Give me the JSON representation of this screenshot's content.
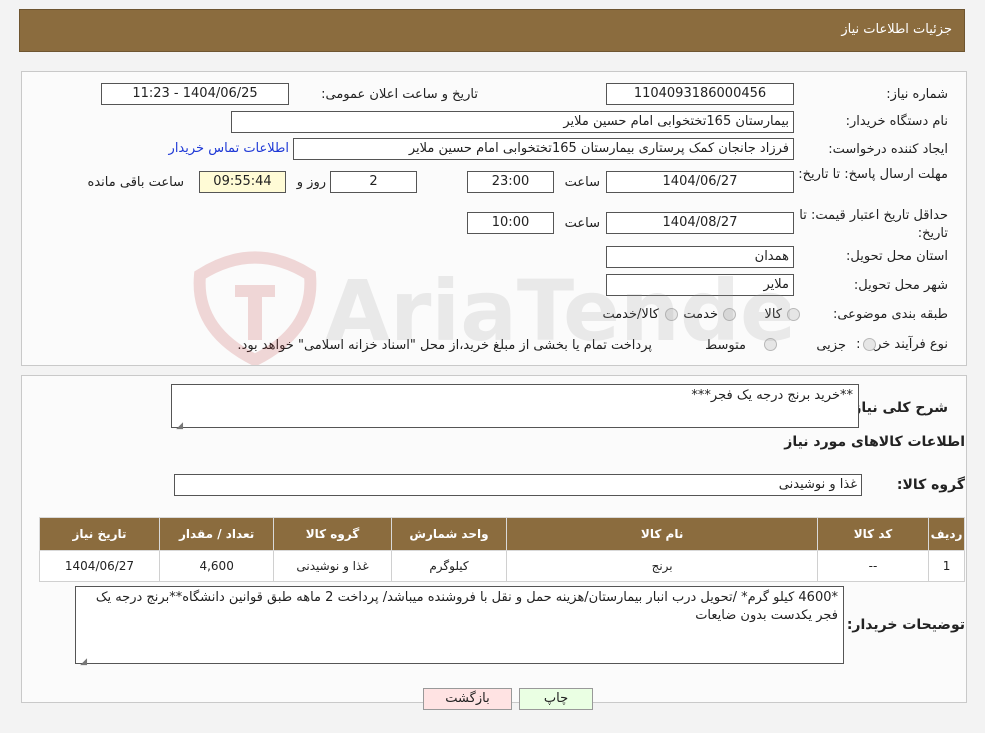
{
  "header": {
    "title": "جزئیات اطلاعات نیاز"
  },
  "form": {
    "need_number_label": "شماره نیاز:",
    "need_number": "1104093186000456",
    "announce_label": "تاریخ و ساعت اعلان عمومی:",
    "announce_value": "1404/06/25 - 11:23",
    "buyer_label": "نام دستگاه خریدار:",
    "buyer_value": "بیمارستان 165تختخوابی امام حسین ملایر",
    "creator_label": "ایجاد کننده درخواست:",
    "creator_value": "فرزاد جانجان کمک پرستاری بیمارستان 165تختخوابی امام حسین ملایر",
    "contact_link": "اطلاعات تماس خریدار",
    "deadline_label": "مهلت ارسال پاسخ: تا تاریخ:",
    "deadline_date": "1404/06/27",
    "time_label": "ساعت",
    "deadline_time": "23:00",
    "days_value": "2",
    "days_label": "روز و",
    "remaining_time": "09:55:44",
    "remaining_label": "ساعت باقی مانده",
    "validity_label": "حداقل تاریخ اعتبار قیمت: تا تاریخ:",
    "validity_date": "1404/08/27",
    "validity_time": "10:00",
    "province_label": "استان محل تحویل:",
    "province_value": "همدان",
    "city_label": "شهر محل تحویل:",
    "city_value": "ملایر",
    "category_label": "طبقه بندی موضوعی:",
    "category_options": [
      "کالا",
      "خدمت",
      "کالا/خدمت"
    ],
    "process_label": "نوع فرآیند خرید :",
    "process_options": [
      "جزیی",
      "متوسط"
    ],
    "process_note": "پرداخت تمام یا بخشی از مبلغ خرید،از محل \"اسناد خزانه اسلامی\" خواهد بود."
  },
  "details": {
    "summary_label": "شرح کلی نیاز:",
    "summary_value": "**خرید برنج درجه یک فجر***",
    "goods_title": "اطلاعات کالاهای مورد نیاز",
    "group_label": "گروه کالا:",
    "group_value": "غذا و نوشیدنی",
    "table_headers": [
      "ردیف",
      "کد کالا",
      "نام کالا",
      "واحد شمارش",
      "گروه کالا",
      "تعداد / مقدار",
      "تاریخ نیاز"
    ],
    "table_rows": [
      [
        "1",
        "--",
        "برنج",
        "کیلوگرم",
        "غذا و نوشیدنی",
        "4,600",
        "1404/06/27"
      ]
    ],
    "buyer_notes_label": "توضیحات خریدار:",
    "buyer_notes_value": "*4600 کیلو گرم* /تحویل درب انبار بیمارستان/هزینه حمل و نقل با فروشنده میباشد/ پرداخت 2 ماهه طبق قوانین دانشگاه**برنج درجه یک فجر یکدست بدون ضایعات"
  },
  "buttons": {
    "print": "چاپ",
    "back": "بازگشت"
  },
  "watermark": "AriaTender.neT"
}
